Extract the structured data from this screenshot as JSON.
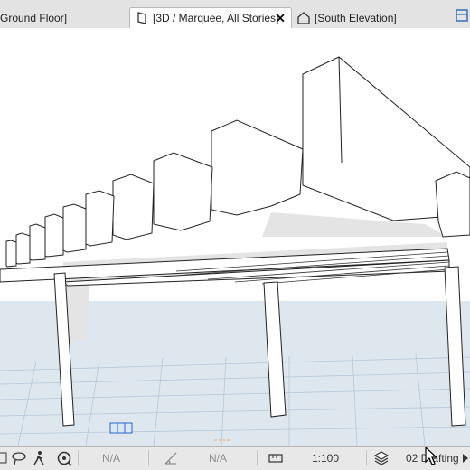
{
  "tabs": [
    {
      "label": "Ground Floor]",
      "icon": "floor-plan-icon"
    },
    {
      "label": "[3D / Marquee, All Stories]",
      "icon": "3d-window-icon",
      "close": "✕"
    },
    {
      "label": "[South Elevation]",
      "icon": "elevation-house-icon"
    }
  ],
  "statusbar": {
    "zoom_na": "N/A",
    "angle_na": "N/A",
    "scale": "1:100",
    "layer_combo": "02 Drafting"
  },
  "icons": {
    "window_settings": "grid-window-icon",
    "undo": "lasso-icon",
    "walk": "walk-icon",
    "navigator": "navigator-icon",
    "measure": "angle-icon",
    "scale": "ruler-icon",
    "layers": "layers-icon",
    "next": "arrow-right-icon"
  },
  "colors": {
    "ground": "#dfe7ee",
    "grid": "#b6c8d8",
    "accent": "#f0a259"
  }
}
